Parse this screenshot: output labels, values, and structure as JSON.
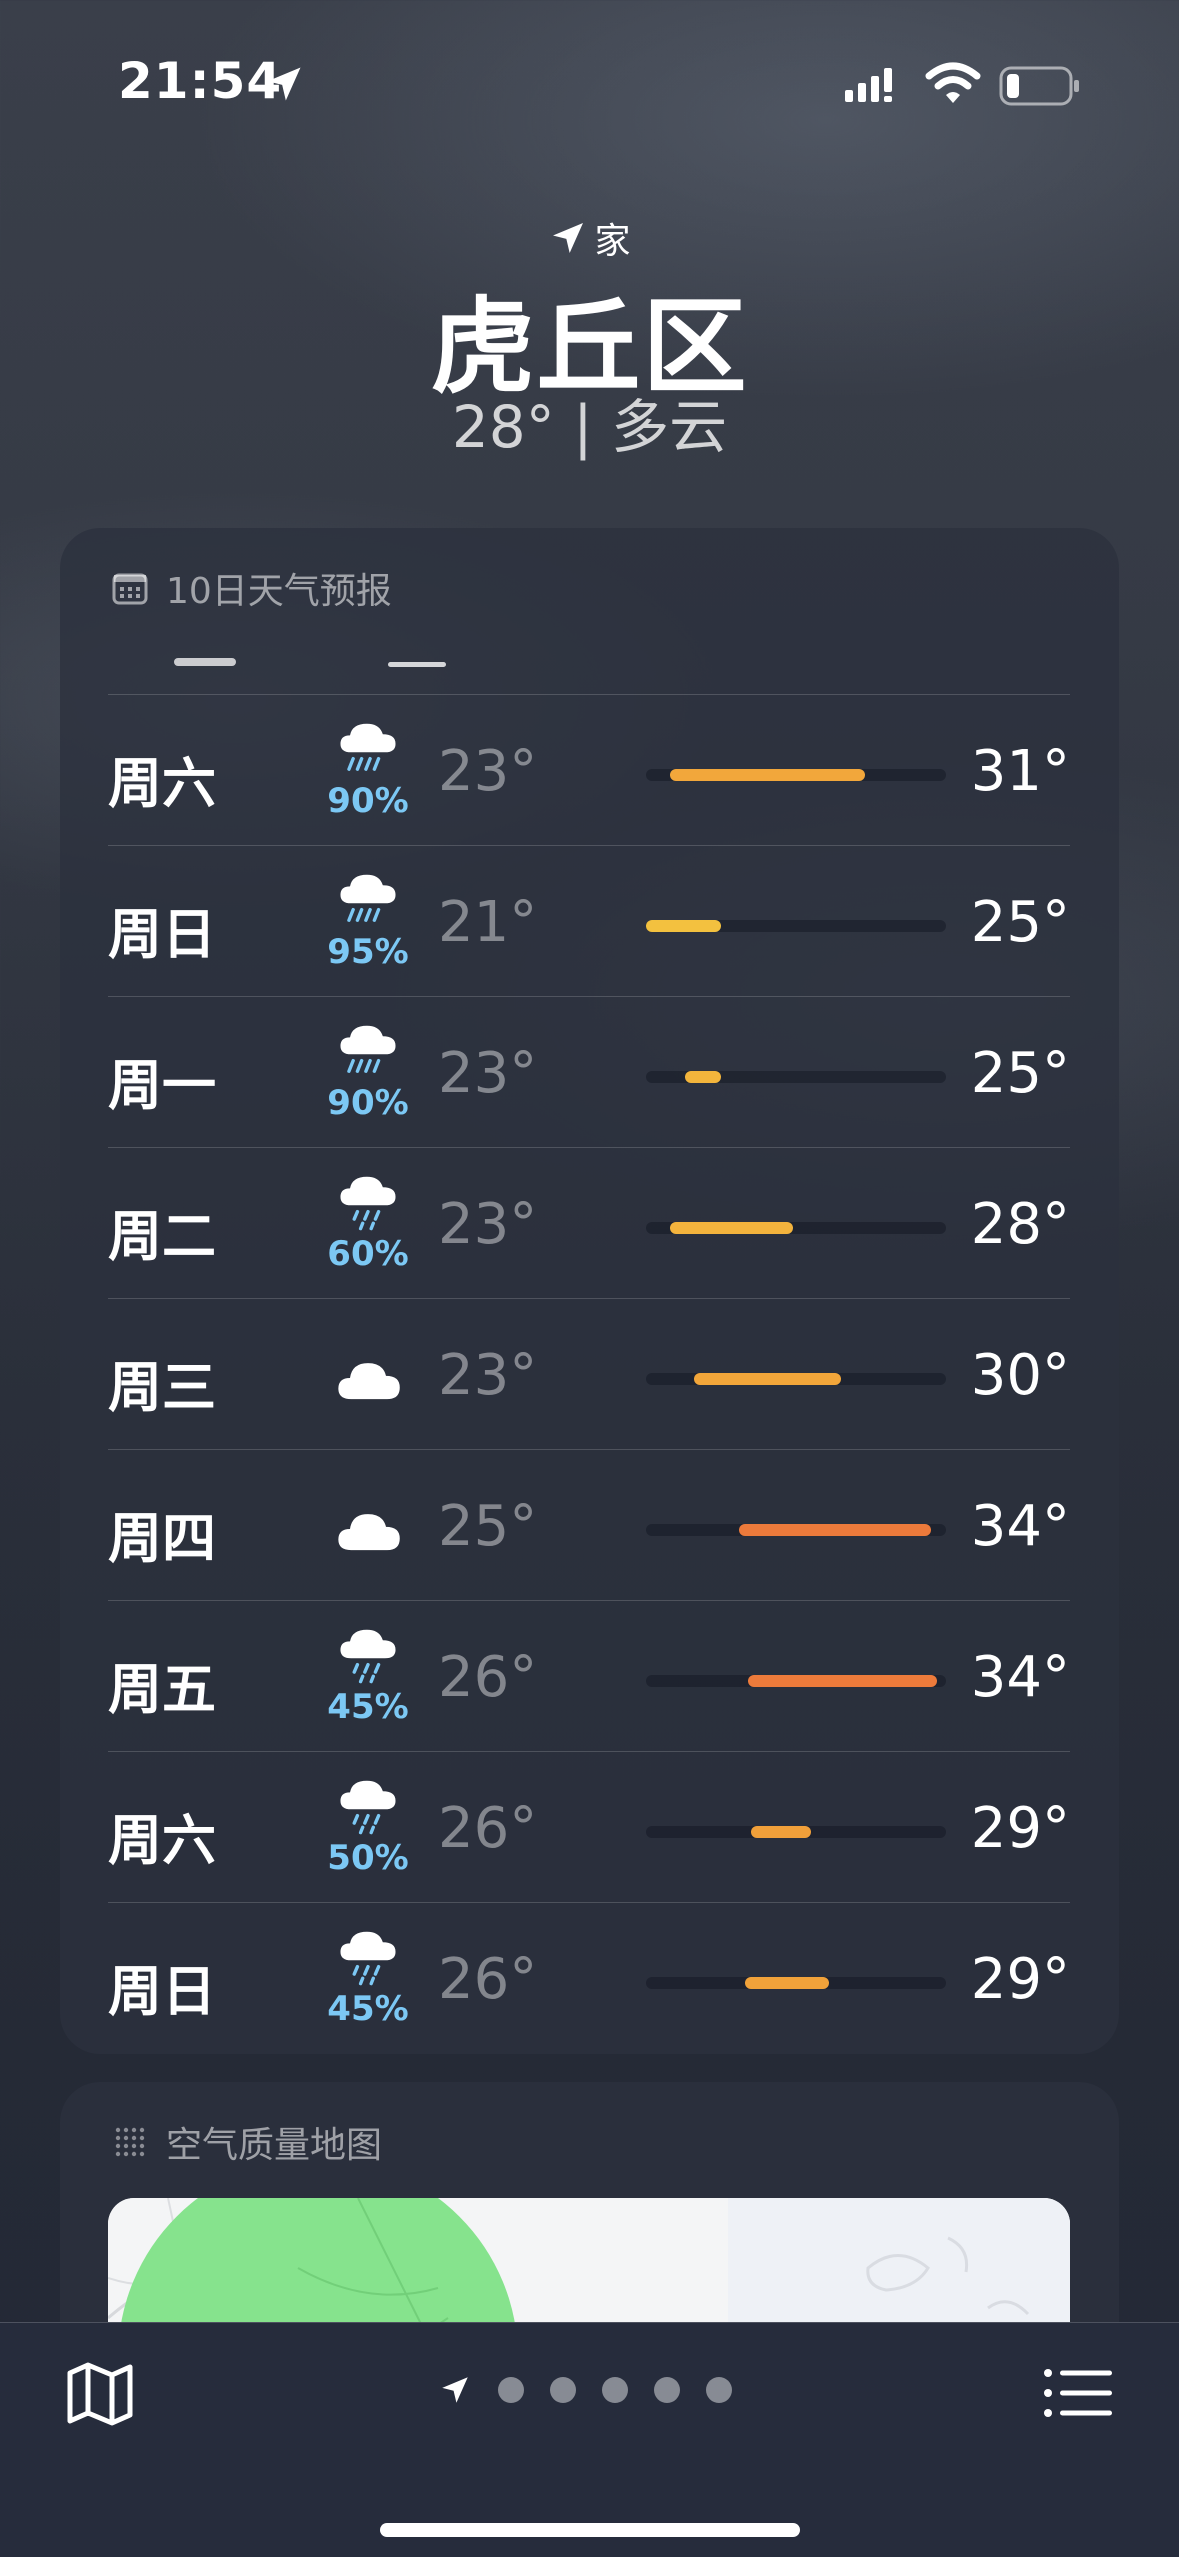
{
  "status": {
    "time": "21:54"
  },
  "location": {
    "label": "家",
    "city": "虎丘区",
    "current": "28° | 多云"
  },
  "forecast": {
    "title": "10日天气预报",
    "rows": [
      {
        "day": "周六",
        "icon": "cloud-rain-heavy-icon",
        "prob": "90%",
        "low": "23°",
        "high": "31°",
        "bar_start": 0.08,
        "bar_end": 0.73,
        "bar_color": "#f2a73b"
      },
      {
        "day": "周日",
        "icon": "cloud-rain-heavy-icon",
        "prob": "95%",
        "low": "21°",
        "high": "25°",
        "bar_start": 0.0,
        "bar_end": 0.25,
        "bar_color": "#f3c13f"
      },
      {
        "day": "周一",
        "icon": "cloud-rain-heavy-icon",
        "prob": "90%",
        "low": "23°",
        "high": "25°",
        "bar_start": 0.13,
        "bar_end": 0.25,
        "bar_color": "#f3b53c"
      },
      {
        "day": "周二",
        "icon": "cloud-rain-light-icon",
        "prob": "60%",
        "low": "23°",
        "high": "28°",
        "bar_start": 0.08,
        "bar_end": 0.49,
        "bar_color": "#f3b33d"
      },
      {
        "day": "周三",
        "icon": "cloud-icon",
        "prob": "",
        "low": "23°",
        "high": "30°",
        "bar_start": 0.16,
        "bar_end": 0.65,
        "bar_color": "#f2a63a"
      },
      {
        "day": "周四",
        "icon": "cloud-icon",
        "prob": "",
        "low": "25°",
        "high": "34°",
        "bar_start": 0.31,
        "bar_end": 0.95,
        "bar_color": "#ec7a3b"
      },
      {
        "day": "周五",
        "icon": "cloud-rain-light-icon",
        "prob": "45%",
        "low": "26°",
        "high": "34°",
        "bar_start": 0.34,
        "bar_end": 0.97,
        "bar_color": "#ed7b3b"
      },
      {
        "day": "周六",
        "icon": "cloud-rain-light-icon",
        "prob": "50%",
        "low": "26°",
        "high": "29°",
        "bar_start": 0.35,
        "bar_end": 0.55,
        "bar_color": "#f1a03a"
      },
      {
        "day": "周日",
        "icon": "cloud-rain-light-icon",
        "prob": "45%",
        "low": "26°",
        "high": "29°",
        "bar_start": 0.33,
        "bar_end": 0.61,
        "bar_color": "#f1a23a"
      }
    ]
  },
  "air_quality": {
    "title": "空气质量地图"
  },
  "page_indicator": {
    "count": 5
  }
}
